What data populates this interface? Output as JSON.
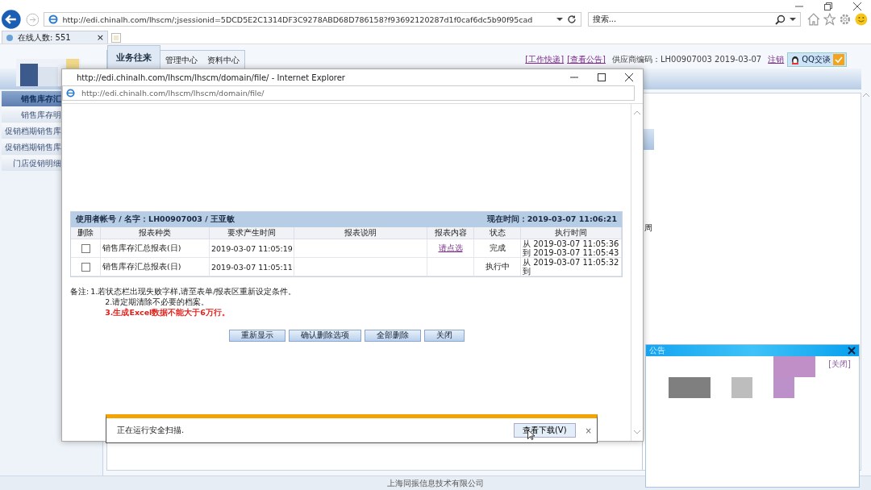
{
  "browser": {
    "address": "http://edi.chinalh.com/lhscm/;jsessionid=5DCD5E2C1314DF3C9278ABD68D786158?f93692120287d1f0caf6dc5b90f95cad",
    "search_placeholder": "搜索...",
    "tab": {
      "title": "在线人数: 551",
      "close": "×"
    }
  },
  "site": {
    "tabs": [
      {
        "label": "业务往来",
        "selected": true
      },
      {
        "label": "管理中心",
        "selected": false
      },
      {
        "label": "资料中心",
        "selected": false
      }
    ],
    "links": [
      "[工作快递]",
      "[查看公告]"
    ],
    "supplier": "供应商编码：LH00907003  2019-03-07",
    "logout": "注销",
    "qq": "QQ交谈",
    "sidebar": [
      {
        "label": "销售库存汇",
        "selected": true
      },
      {
        "label": "销售库存明",
        "selected": false
      },
      {
        "label": "促销档期销售库",
        "selected": false
      },
      {
        "label": "促销档期销售库",
        "selected": false
      },
      {
        "label": "门店促销明细",
        "selected": false
      }
    ],
    "side_text": "周",
    "footer": "上海同振信息技术有限公司"
  },
  "popup": {
    "title": "http://edi.chinalh.com/lhscm/lhscm/domain/file/ - Internet Explorer",
    "address": "http://edi.chinalh.com/lhscm/lhscm/domain/file/",
    "header_left": "使用者帐号 / 名字：LH00907003 / 王亚敏",
    "header_right": "现在时间：2019-03-07 11:06:21",
    "columns": [
      "删除",
      "报表种类",
      "要求产生时间",
      "报表说明",
      "报表内容",
      "状态",
      "执行时间"
    ],
    "rows": [
      {
        "checked": false,
        "type": "销售库存汇总报表(日)",
        "requested": "2019-03-07 11:05:19",
        "link": "请点选",
        "status": "完成",
        "exec": [
          "从 2019-03-07 11:05:36",
          "到 2019-03-07 11:05:43"
        ]
      },
      {
        "checked": false,
        "type": "销售库存汇总报表(日)",
        "requested": "2019-03-07 11:05:11",
        "status": "执行中",
        "exec": [
          "从 2019-03-07 11:05:32",
          "到"
        ]
      }
    ],
    "notes_label": "备注:",
    "notes": [
      {
        "text": "1.若状态栏出现失败字样,请至表单/报表区重新设定条件。",
        "kind": "normal"
      },
      {
        "text": "2.请定期清除不必要的档案。",
        "kind": "normal"
      },
      {
        "text": "3.生成Excel数据不能大于6万行。",
        "kind": "warning"
      }
    ],
    "buttons": [
      "重新显示",
      "确认删除选项",
      "全部删除",
      "关闭"
    ]
  },
  "download_bar": {
    "message": "正在运行安全扫描.",
    "button": "查看下载(V)",
    "close": "×"
  },
  "notice": {
    "title": "公告",
    "close_link": "[关闭]"
  }
}
